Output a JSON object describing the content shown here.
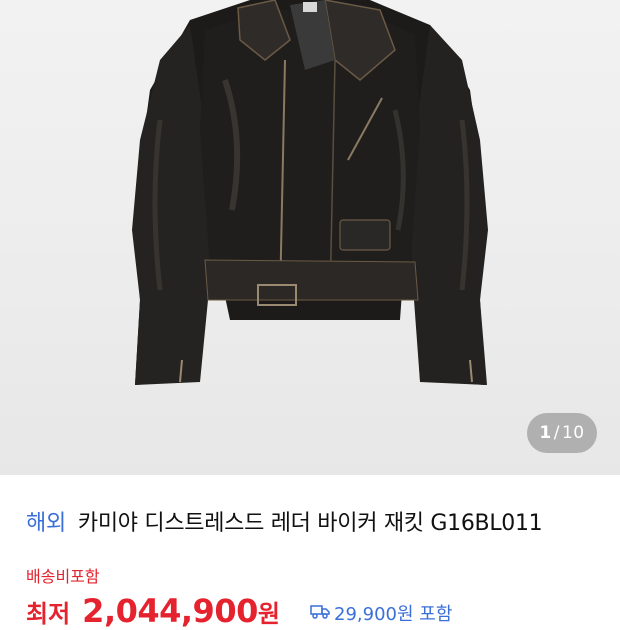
{
  "gallery": {
    "current": "1",
    "separator": "/",
    "total": "10"
  },
  "product": {
    "origin_tag": "해외",
    "title": "카미야 디스트레스드 레더 바이커 재킷 G16BL011"
  },
  "shipping_note": "배송비포함",
  "price": {
    "label": "최저",
    "amount": "2,044,900",
    "unit": "원"
  },
  "shipping_fee": {
    "icon": "truck-icon",
    "text": "29,900원 포함"
  },
  "colors": {
    "accent_red": "#e5232f",
    "accent_blue": "#3a6fd8"
  }
}
